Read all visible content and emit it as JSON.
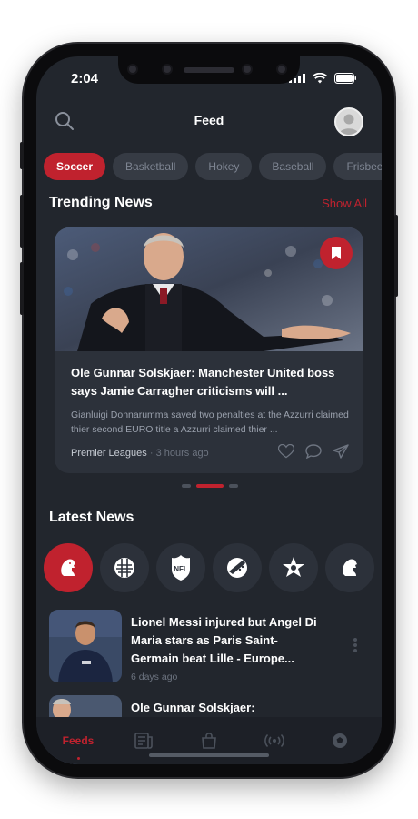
{
  "status": {
    "time": "2:04"
  },
  "header": {
    "title": "Feed"
  },
  "categories": [
    {
      "label": "Soccer",
      "active": true
    },
    {
      "label": "Basketball",
      "active": false
    },
    {
      "label": "Hokey",
      "active": false
    },
    {
      "label": "Baseball",
      "active": false
    },
    {
      "label": "Frisbees",
      "active": false
    }
  ],
  "trending": {
    "title": "Trending News",
    "show_all": "Show All",
    "card": {
      "headline": "Ole Gunnar Solskjaer: Manchester United boss says Jamie Carragher criticisms will ...",
      "excerpt": "Gianluigi Donnarumma saved two penalties at the Azzurri claimed thier second EURO title a Azzurri claimed thier ...",
      "source": "Premier Leagues",
      "separator": "·",
      "time": "3 hours ago"
    }
  },
  "latest": {
    "title": "Latest News",
    "items": [
      {
        "headline": "Lionel Messi injured but Angel Di Maria stars as Paris Saint-Germain beat Lille - Europe...",
        "time": "6 days ago"
      },
      {
        "headline": "Ole Gunnar Solskjaer: Manchester United boss says",
        "time": ""
      }
    ]
  },
  "leagues": [
    "premier-league",
    "serie-a",
    "nfl",
    "mls",
    "la-liga",
    "premier-league"
  ],
  "nav": {
    "feeds": "Feeds"
  },
  "colors": {
    "accent": "#c0222e",
    "background": "#22262d",
    "card": "#2c313a"
  }
}
